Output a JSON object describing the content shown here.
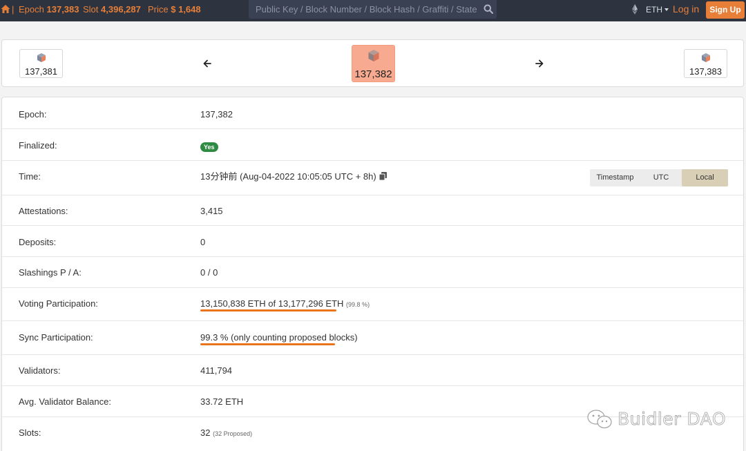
{
  "header": {
    "epoch_label": "Epoch",
    "epoch_value": "137,383",
    "slot_label": "Slot",
    "slot_value": "4,396,287",
    "price_label": "Price",
    "price_value": "$ 1,648",
    "search_placeholder": "Public Key / Block Number / Block Hash / Graffiti / State",
    "currency": "ETH",
    "login": "Log in",
    "signup": "Sign Up"
  },
  "epoch_nav": {
    "prev": "137,381",
    "current": "137,382",
    "next": "137,383"
  },
  "details": {
    "epoch": {
      "label": "Epoch:",
      "value": "137,382"
    },
    "finalized": {
      "label": "Finalized:",
      "value": "Yes"
    },
    "time": {
      "label": "Time:",
      "value": "13分钟前 (Aug-04-2022 10:05:05 UTC + 8h)",
      "modes": [
        "Timestamp",
        "UTC",
        "Local"
      ],
      "active_mode": "Local"
    },
    "attestations": {
      "label": "Attestations:",
      "value": "3,415"
    },
    "deposits": {
      "label": "Deposits:",
      "value": "0"
    },
    "slashings": {
      "label": "Slashings P / A:",
      "value": "0 / 0"
    },
    "voting": {
      "label": "Voting Participation:",
      "value": "13,150,838 ETH of 13,177,296 ETH",
      "pct": "(99.8 %)"
    },
    "sync": {
      "label": "Sync Participation:",
      "value": "99.3 % (only counting proposed blocks)"
    },
    "validators": {
      "label": "Validators:",
      "value": "411,794"
    },
    "balance": {
      "label": "Avg. Validator Balance:",
      "value": "33.72 ETH"
    },
    "slots": {
      "label": "Slots:",
      "value": "32",
      "note": "(32 Proposed)"
    }
  },
  "watermark": "Buidler DAO",
  "colors": {
    "nav_bg": "#2d3440",
    "accent": "#e87f38",
    "current_epoch": "#f7aa90",
    "finalized_badge": "#2f8a43",
    "highlight": "#e8741c"
  }
}
